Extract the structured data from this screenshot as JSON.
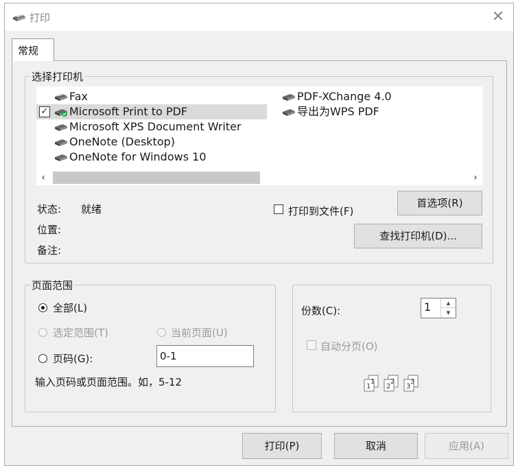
{
  "window": {
    "title": "打印",
    "close_symbol": "✕"
  },
  "tabs": [
    {
      "label": "常规"
    }
  ],
  "select_printer": {
    "legend": "选择打印机",
    "printers_col1": [
      {
        "name": "Fax",
        "checked": false,
        "selected": false
      },
      {
        "name": "Microsoft Print to PDF",
        "checked": true,
        "selected": true
      },
      {
        "name": "Microsoft XPS Document Writer",
        "checked": false,
        "selected": false
      },
      {
        "name": "OneNote (Desktop)",
        "checked": false,
        "selected": false
      },
      {
        "name": "OneNote for Windows 10",
        "checked": false,
        "selected": false
      }
    ],
    "printers_col2": [
      {
        "name": "PDF-XChange 4.0"
      },
      {
        "name": "导出为WPS PDF"
      }
    ],
    "scroll_left": "‹",
    "scroll_right": "›",
    "status_label": "状态:",
    "status_value": "就绪",
    "location_label": "位置:",
    "location_value": "",
    "comment_label": "备注:",
    "comment_value": "",
    "print_to_file_label": "打印到文件(F)",
    "print_to_file_checked": false,
    "preferences_button": "首选项(R)",
    "find_printer_button": "查找打印机(D)..."
  },
  "page_range": {
    "legend": "页面范围",
    "all_label": "全部(L)",
    "selection_label": "选定范围(T)",
    "current_page_label": "当前页面(U)",
    "pages_label": "页码(G):",
    "pages_value": "0-1",
    "hint": "输入页码或页面范围。如，5-12",
    "selected_option": "all"
  },
  "copies": {
    "label": "份数(C):",
    "value": "1",
    "collate_label": "自动分页(O)",
    "collate_checked": false,
    "collate_icon_pages": [
      "1",
      "1",
      "2",
      "2",
      "3",
      "3"
    ]
  },
  "footer": {
    "print_button": "打印(P)",
    "cancel_button": "取消",
    "apply_button": "应用(A)"
  },
  "icons": {
    "title": "printer-icon",
    "printer": "printer-icon",
    "default_badge": "checkmark-badge-icon",
    "collate": "collate-pages-icon"
  },
  "colors": {
    "dialog_bg": "#f0f0f0",
    "selected_row": "#dadada",
    "default_badge": "#16a34a",
    "disabled_text": "#9a9a9a"
  }
}
